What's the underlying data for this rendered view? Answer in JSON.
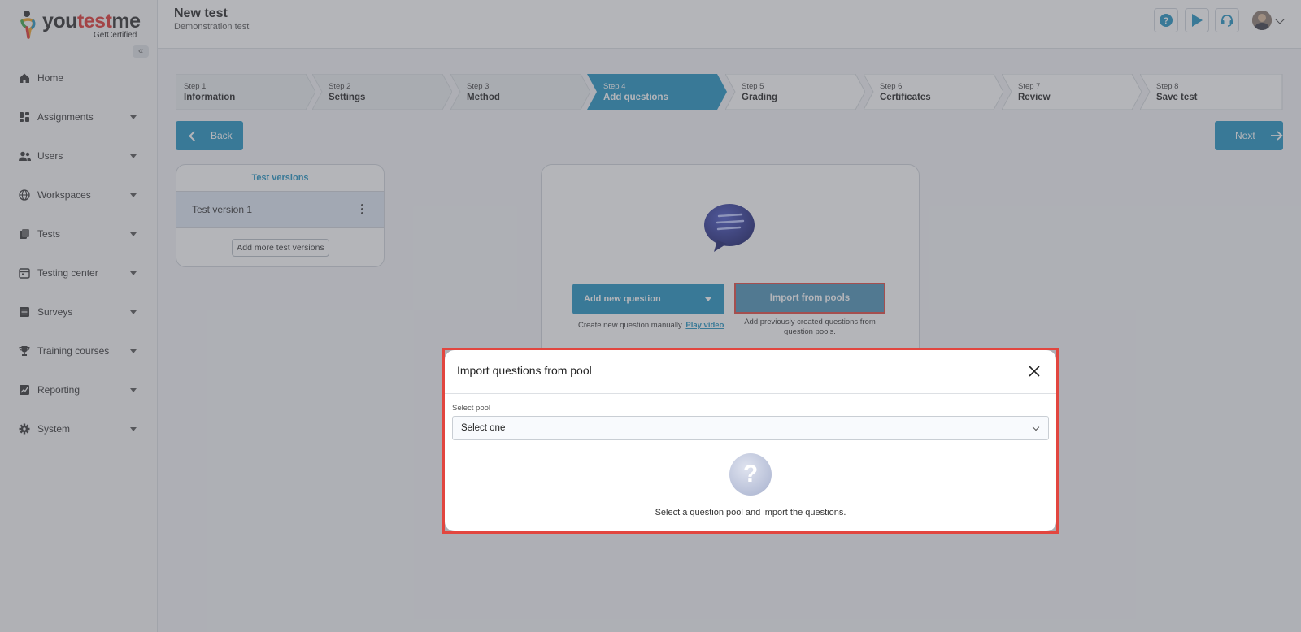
{
  "brand": {
    "name_part1": "you",
    "name_part2": "test",
    "name_part3": "me",
    "tagline": "GetCertified"
  },
  "sidebar": {
    "collapse_label": "«",
    "items": [
      {
        "label": "Home",
        "icon": "home-icon",
        "has_caret": false
      },
      {
        "label": "Assignments",
        "icon": "dashboard-icon",
        "has_caret": true
      },
      {
        "label": "Users",
        "icon": "users-icon",
        "has_caret": true
      },
      {
        "label": "Workspaces",
        "icon": "globe-icon",
        "has_caret": true
      },
      {
        "label": "Tests",
        "icon": "tests-icon",
        "has_caret": true
      },
      {
        "label": "Testing center",
        "icon": "calendar-icon",
        "has_caret": true
      },
      {
        "label": "Surveys",
        "icon": "list-icon",
        "has_caret": true
      },
      {
        "label": "Training courses",
        "icon": "trophy-icon",
        "has_caret": true
      },
      {
        "label": "Reporting",
        "icon": "chart-icon",
        "has_caret": true
      },
      {
        "label": "System",
        "icon": "gear-icon",
        "has_caret": true
      }
    ]
  },
  "header": {
    "title": "New test",
    "subtitle": "Demonstration test"
  },
  "stepper": {
    "steps": [
      {
        "num": "Step 1",
        "name": "Information",
        "state": "done"
      },
      {
        "num": "Step 2",
        "name": "Settings",
        "state": "done"
      },
      {
        "num": "Step 3",
        "name": "Method",
        "state": "done"
      },
      {
        "num": "Step 4",
        "name": "Add questions",
        "state": "active"
      },
      {
        "num": "Step 5",
        "name": "Grading",
        "state": "todo"
      },
      {
        "num": "Step 6",
        "name": "Certificates",
        "state": "todo"
      },
      {
        "num": "Step 7",
        "name": "Review",
        "state": "todo"
      },
      {
        "num": "Step 8",
        "name": "Save test",
        "state": "todo"
      }
    ]
  },
  "nav_buttons": {
    "back": "Back",
    "next": "Next"
  },
  "versions": {
    "title": "Test versions",
    "items": [
      "Test version 1"
    ],
    "add_more": "Add more test versions"
  },
  "questions": {
    "add_new": "Add new question",
    "import": "Import from pools",
    "hint_left": "Create new question manually.",
    "hint_left_link": "Play video",
    "hint_right": "Add previously created questions from question pools."
  },
  "modal": {
    "title": "Import questions from pool",
    "select_label": "Select pool",
    "select_value": "Select one",
    "empty_glyph": "?",
    "empty_text": "Select a question pool and import the questions."
  },
  "colors": {
    "primary": "#1f93c2",
    "highlight": "#e2463f",
    "active_row": "#dfe8f5"
  }
}
